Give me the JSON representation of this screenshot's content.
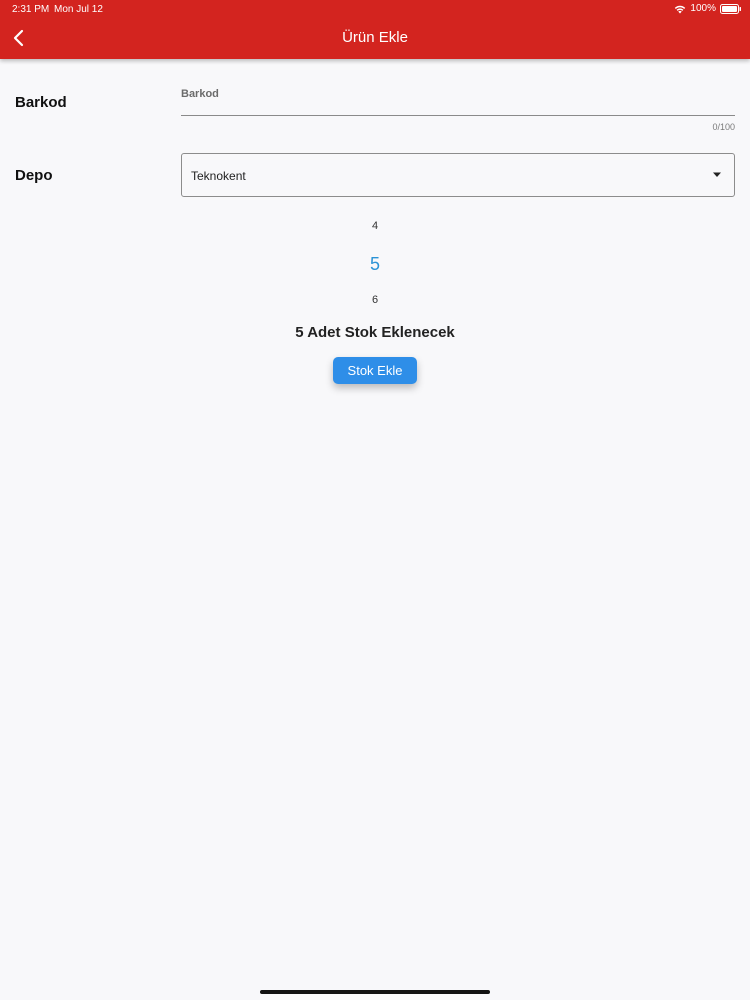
{
  "status_bar": {
    "time": "2:31 PM",
    "date": "Mon Jul 12",
    "battery": "100%",
    "icons": [
      "wifi-icon",
      "battery-icon"
    ]
  },
  "header": {
    "title": "Ürün Ekle",
    "back_icon": "chevron-left-icon",
    "background": "#d3241f"
  },
  "form": {
    "barcode": {
      "label": "Barkod",
      "field_label": "Barkod",
      "value": "",
      "counter": "0/100"
    },
    "depot": {
      "label": "Depo",
      "selected": "Teknokent",
      "icon": "dropdown-arrow-icon"
    },
    "quantity_picker": {
      "previous": "4",
      "current": "5",
      "next": "6",
      "accent": "#2b93d6"
    },
    "summary": "5 Adet Stok Eklenecek",
    "submit_label": "Stok Ekle",
    "submit_color": "#2e8ee8"
  }
}
